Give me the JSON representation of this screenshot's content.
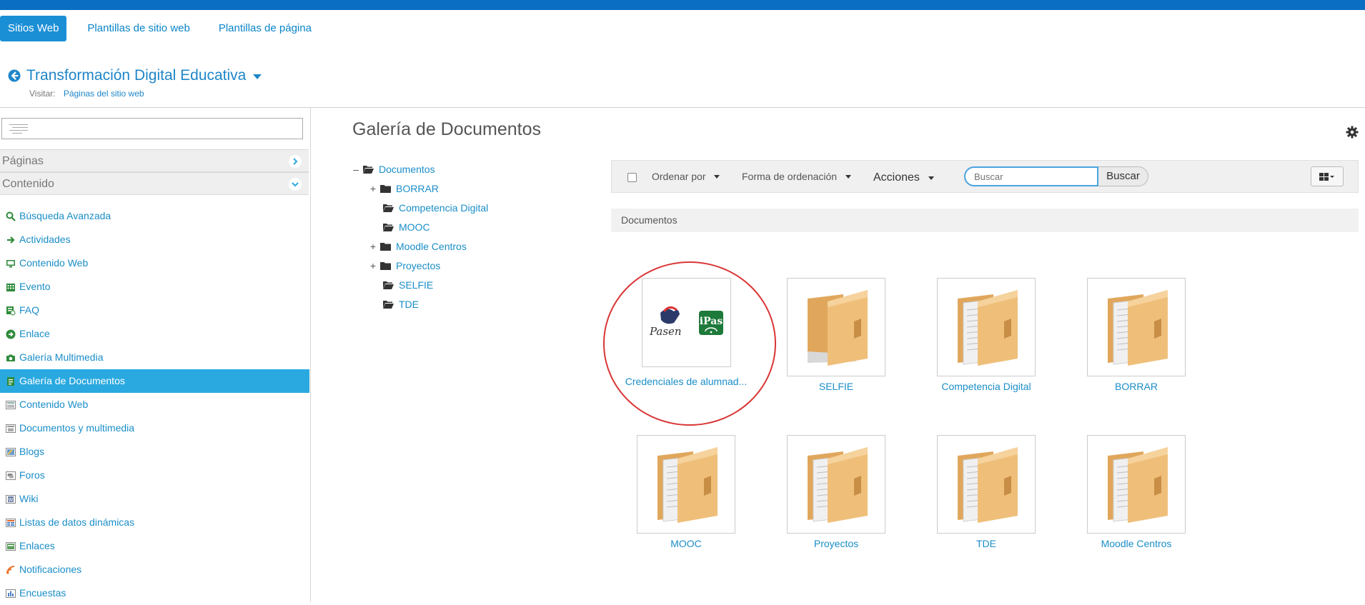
{
  "top_tabs": [
    {
      "label": "Sitios Web",
      "active": true
    },
    {
      "label": "Plantillas de sitio web",
      "active": false
    },
    {
      "label": "Plantillas de página",
      "active": false
    }
  ],
  "site": {
    "title": "Transformación Digital Educativa",
    "visit_label": "Visitar:",
    "visit_link": "Páginas del sitio web"
  },
  "sidebar": {
    "search_placeholder": "",
    "sections": {
      "pages": "Páginas",
      "content": "Contenido"
    },
    "items": [
      {
        "label": "Búsqueda Avanzada",
        "icon": "magnifier-icon",
        "active": false
      },
      {
        "label": "Actividades",
        "icon": "arrow-right-icon",
        "active": false
      },
      {
        "label": "Contenido Web",
        "icon": "monitor-icon",
        "active": false
      },
      {
        "label": "Evento",
        "icon": "calendar-grid-icon",
        "active": false
      },
      {
        "label": "FAQ",
        "icon": "faq-icon",
        "active": false
      },
      {
        "label": "Enlace",
        "icon": "link-circle-icon",
        "active": false
      },
      {
        "label": "Galería Multimedia",
        "icon": "camera-icon",
        "active": false
      },
      {
        "label": "Galería de Documentos",
        "icon": "document-icon",
        "active": true
      },
      {
        "label": "Contenido Web",
        "icon": "portlet-icon",
        "active": false
      },
      {
        "label": "Documentos y multimedia",
        "icon": "portlet-icon",
        "active": false
      },
      {
        "label": "Blogs",
        "icon": "blogs-icon",
        "active": false
      },
      {
        "label": "Foros",
        "icon": "forums-icon",
        "active": false
      },
      {
        "label": "Wiki",
        "icon": "wiki-icon",
        "active": false
      },
      {
        "label": "Listas de datos dinámicas",
        "icon": "lists-icon",
        "active": false
      },
      {
        "label": "Enlaces",
        "icon": "links-icon",
        "active": false
      },
      {
        "label": "Notificaciones",
        "icon": "rss-icon",
        "active": false
      },
      {
        "label": "Encuestas",
        "icon": "poll-icon",
        "active": false
      }
    ]
  },
  "main": {
    "title": "Galería de Documentos",
    "tree": {
      "root": "Documentos",
      "children": [
        {
          "label": "BORRAR",
          "expandable": true
        },
        {
          "label": "Competencia Digital",
          "expandable": false
        },
        {
          "label": "MOOC",
          "expandable": false
        },
        {
          "label": "Moodle Centros",
          "expandable": true
        },
        {
          "label": "Proyectos",
          "expandable": true
        },
        {
          "label": "SELFIE",
          "expandable": false
        },
        {
          "label": "TDE",
          "expandable": false
        }
      ]
    },
    "toolbar": {
      "order_by": "Ordenar por",
      "order_type": "Forma de ordenación",
      "actions": "Acciones",
      "search_placeholder": "Buscar",
      "search_button": "Buscar"
    },
    "breadcrumb": "Documentos",
    "cards": [
      {
        "label": "Credenciales de alumnad...",
        "type": "document",
        "thumb_left": "Pasen",
        "thumb_right": "iPas"
      },
      {
        "label": "SELFIE",
        "type": "folder-empty"
      },
      {
        "label": "Competencia Digital",
        "type": "folder"
      },
      {
        "label": "BORRAR",
        "type": "folder"
      },
      {
        "label": "MOOC",
        "type": "folder"
      },
      {
        "label": "Proyectos",
        "type": "folder"
      },
      {
        "label": "TDE",
        "type": "folder"
      },
      {
        "label": "Moodle Centros",
        "type": "folder"
      }
    ]
  },
  "colors": {
    "brand_blue": "#0a6fc2",
    "link_blue": "#1a8ec8",
    "active_item": "#2aa9e0",
    "highlight_red": "#d93535",
    "folder_orange": "#e8b66e"
  }
}
